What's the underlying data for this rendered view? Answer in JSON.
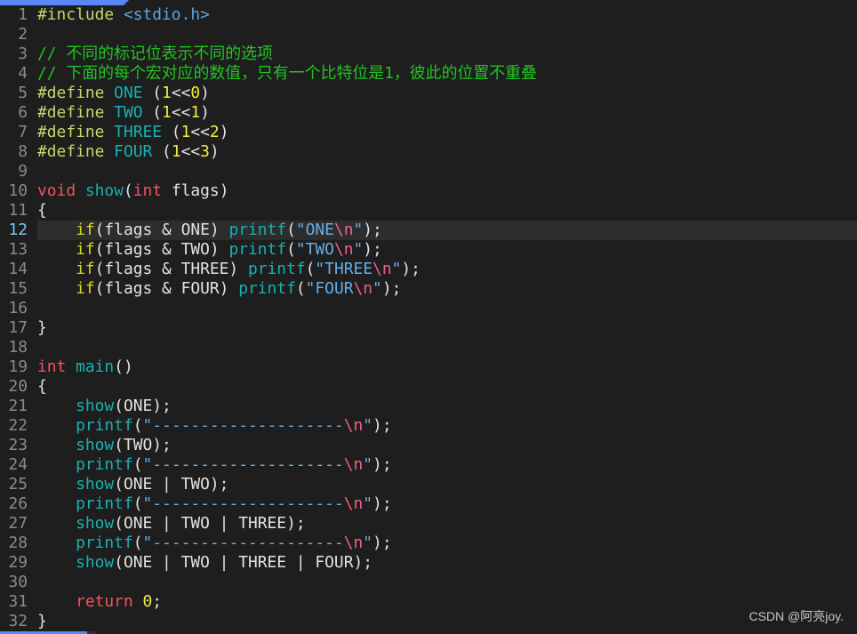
{
  "editor": {
    "current_line": 12,
    "lines": [
      [
        [
          "pre",
          "#include "
        ],
        [
          "inc",
          "<stdio.h>"
        ]
      ],
      [],
      [
        [
          "com",
          "// 不同的标记位表示不同的选项"
        ]
      ],
      [
        [
          "com",
          "// 下面的每个宏对应的数值，只有一个比特位是1，彼此的位置不重叠"
        ]
      ],
      [
        [
          "pre",
          "#define "
        ],
        [
          "mac",
          "ONE"
        ],
        [
          "txt",
          " ("
        ],
        [
          "num",
          "1"
        ],
        [
          "txt",
          "<<"
        ],
        [
          "num",
          "0"
        ],
        [
          "txt",
          ")"
        ]
      ],
      [
        [
          "pre",
          "#define "
        ],
        [
          "mac",
          "TWO"
        ],
        [
          "txt",
          " ("
        ],
        [
          "num",
          "1"
        ],
        [
          "txt",
          "<<"
        ],
        [
          "num",
          "1"
        ],
        [
          "txt",
          ")"
        ]
      ],
      [
        [
          "pre",
          "#define "
        ],
        [
          "mac",
          "THREE"
        ],
        [
          "txt",
          " ("
        ],
        [
          "num",
          "1"
        ],
        [
          "txt",
          "<<"
        ],
        [
          "num",
          "2"
        ],
        [
          "txt",
          ")"
        ]
      ],
      [
        [
          "pre",
          "#define "
        ],
        [
          "mac",
          "FOUR"
        ],
        [
          "txt",
          " ("
        ],
        [
          "num",
          "1"
        ],
        [
          "txt",
          "<<"
        ],
        [
          "num",
          "3"
        ],
        [
          "txt",
          ")"
        ]
      ],
      [],
      [
        [
          "typ",
          "void"
        ],
        [
          "txt",
          " "
        ],
        [
          "fn",
          "show"
        ],
        [
          "txt",
          "("
        ],
        [
          "typ",
          "int"
        ],
        [
          "txt",
          " flags)"
        ]
      ],
      [
        [
          "txt",
          "{"
        ]
      ],
      [
        [
          "txt",
          "    "
        ],
        [
          "kw",
          "if"
        ],
        [
          "txt",
          "(flags & ONE) "
        ],
        [
          "fn",
          "printf"
        ],
        [
          "txt",
          "("
        ],
        [
          "str",
          "\"ONE"
        ],
        [
          "esc",
          "\\n"
        ],
        [
          "str",
          "\""
        ],
        [
          "txt",
          ");"
        ]
      ],
      [
        [
          "txt",
          "    "
        ],
        [
          "kw",
          "if"
        ],
        [
          "txt",
          "(flags & TWO) "
        ],
        [
          "fn",
          "printf"
        ],
        [
          "txt",
          "("
        ],
        [
          "str",
          "\"TWO"
        ],
        [
          "esc",
          "\\n"
        ],
        [
          "str",
          "\""
        ],
        [
          "txt",
          ");"
        ]
      ],
      [
        [
          "txt",
          "    "
        ],
        [
          "kw",
          "if"
        ],
        [
          "txt",
          "(flags & THREE) "
        ],
        [
          "fn",
          "printf"
        ],
        [
          "txt",
          "("
        ],
        [
          "str",
          "\"THREE"
        ],
        [
          "esc",
          "\\n"
        ],
        [
          "str",
          "\""
        ],
        [
          "txt",
          ");"
        ]
      ],
      [
        [
          "txt",
          "    "
        ],
        [
          "kw",
          "if"
        ],
        [
          "txt",
          "(flags & FOUR) "
        ],
        [
          "fn",
          "printf"
        ],
        [
          "txt",
          "("
        ],
        [
          "str",
          "\"FOUR"
        ],
        [
          "esc",
          "\\n"
        ],
        [
          "str",
          "\""
        ],
        [
          "txt",
          ");"
        ]
      ],
      [],
      [
        [
          "txt",
          "}"
        ]
      ],
      [],
      [
        [
          "typ",
          "int"
        ],
        [
          "txt",
          " "
        ],
        [
          "fn",
          "main"
        ],
        [
          "txt",
          "()"
        ]
      ],
      [
        [
          "txt",
          "{"
        ]
      ],
      [
        [
          "txt",
          "    "
        ],
        [
          "fn",
          "show"
        ],
        [
          "txt",
          "(ONE);"
        ]
      ],
      [
        [
          "txt",
          "    "
        ],
        [
          "fn",
          "printf"
        ],
        [
          "txt",
          "("
        ],
        [
          "str",
          "\"--------------------"
        ],
        [
          "esc",
          "\\n"
        ],
        [
          "str",
          "\""
        ],
        [
          "txt",
          ");"
        ]
      ],
      [
        [
          "txt",
          "    "
        ],
        [
          "fn",
          "show"
        ],
        [
          "txt",
          "(TWO);"
        ]
      ],
      [
        [
          "txt",
          "    "
        ],
        [
          "fn",
          "printf"
        ],
        [
          "txt",
          "("
        ],
        [
          "str",
          "\"--------------------"
        ],
        [
          "esc",
          "\\n"
        ],
        [
          "str",
          "\""
        ],
        [
          "txt",
          ");"
        ]
      ],
      [
        [
          "txt",
          "    "
        ],
        [
          "fn",
          "show"
        ],
        [
          "txt",
          "(ONE | TWO);"
        ]
      ],
      [
        [
          "txt",
          "    "
        ],
        [
          "fn",
          "printf"
        ],
        [
          "txt",
          "("
        ],
        [
          "str",
          "\"--------------------"
        ],
        [
          "esc",
          "\\n"
        ],
        [
          "str",
          "\""
        ],
        [
          "txt",
          ");"
        ]
      ],
      [
        [
          "txt",
          "    "
        ],
        [
          "fn",
          "show"
        ],
        [
          "txt",
          "(ONE | TWO | THREE);"
        ]
      ],
      [
        [
          "txt",
          "    "
        ],
        [
          "fn",
          "printf"
        ],
        [
          "txt",
          "("
        ],
        [
          "str",
          "\"--------------------"
        ],
        [
          "esc",
          "\\n"
        ],
        [
          "str",
          "\""
        ],
        [
          "txt",
          ");"
        ]
      ],
      [
        [
          "txt",
          "    "
        ],
        [
          "fn",
          "show"
        ],
        [
          "txt",
          "(ONE | TWO | THREE | FOUR);"
        ]
      ],
      [],
      [
        [
          "txt",
          "    "
        ],
        [
          "ret",
          "return"
        ],
        [
          "txt",
          " "
        ],
        [
          "num",
          "0"
        ],
        [
          "txt",
          ";"
        ]
      ],
      [
        [
          "txt",
          "}"
        ]
      ]
    ]
  },
  "watermark": "CSDN @阿亮joy.",
  "colors": {
    "background": "#1e1e1e",
    "tab": "#5b86f5",
    "comment": "#22c322",
    "keyword": "#f2545e",
    "function": "#17b2b2"
  }
}
